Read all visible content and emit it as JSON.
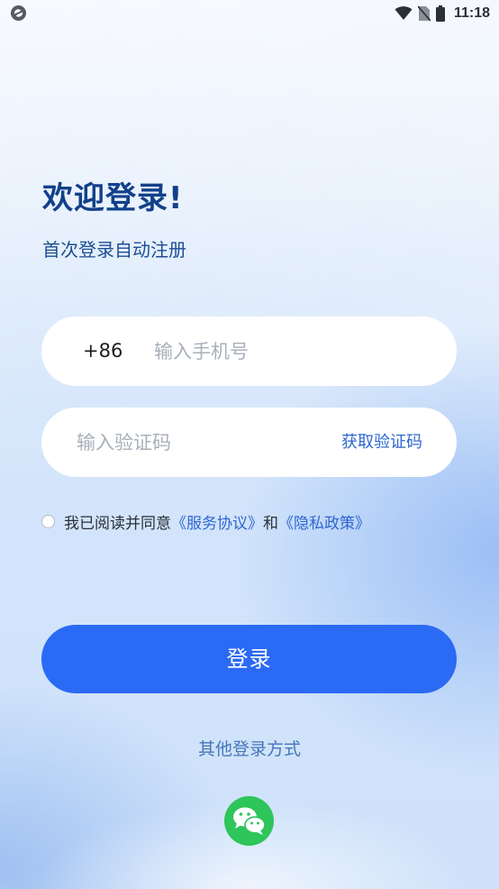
{
  "status_bar": {
    "time": "11:18",
    "icons": [
      "app-icon",
      "wifi-icon",
      "no-sim-icon",
      "battery-icon"
    ]
  },
  "welcome": {
    "title": "欢迎登录!",
    "subtitle": "首次登录自动注册"
  },
  "phone": {
    "country_code": "+86",
    "placeholder": "输入手机号",
    "value": ""
  },
  "verification": {
    "placeholder": "输入验证码",
    "value": "",
    "get_code_label": "获取验证码"
  },
  "agreement": {
    "checked": false,
    "prefix": "我已阅读并同意",
    "service_link": "《服务协议》",
    "connector": "和",
    "privacy_link": "《隐私政策》"
  },
  "login": {
    "label": "登录"
  },
  "other_login": {
    "label": "其他登录方式",
    "options": [
      "wechat-icon"
    ]
  },
  "colors": {
    "primary": "#2b6af4",
    "link": "#2e66cf",
    "title": "#12408a",
    "wechat": "#2ec55a"
  }
}
